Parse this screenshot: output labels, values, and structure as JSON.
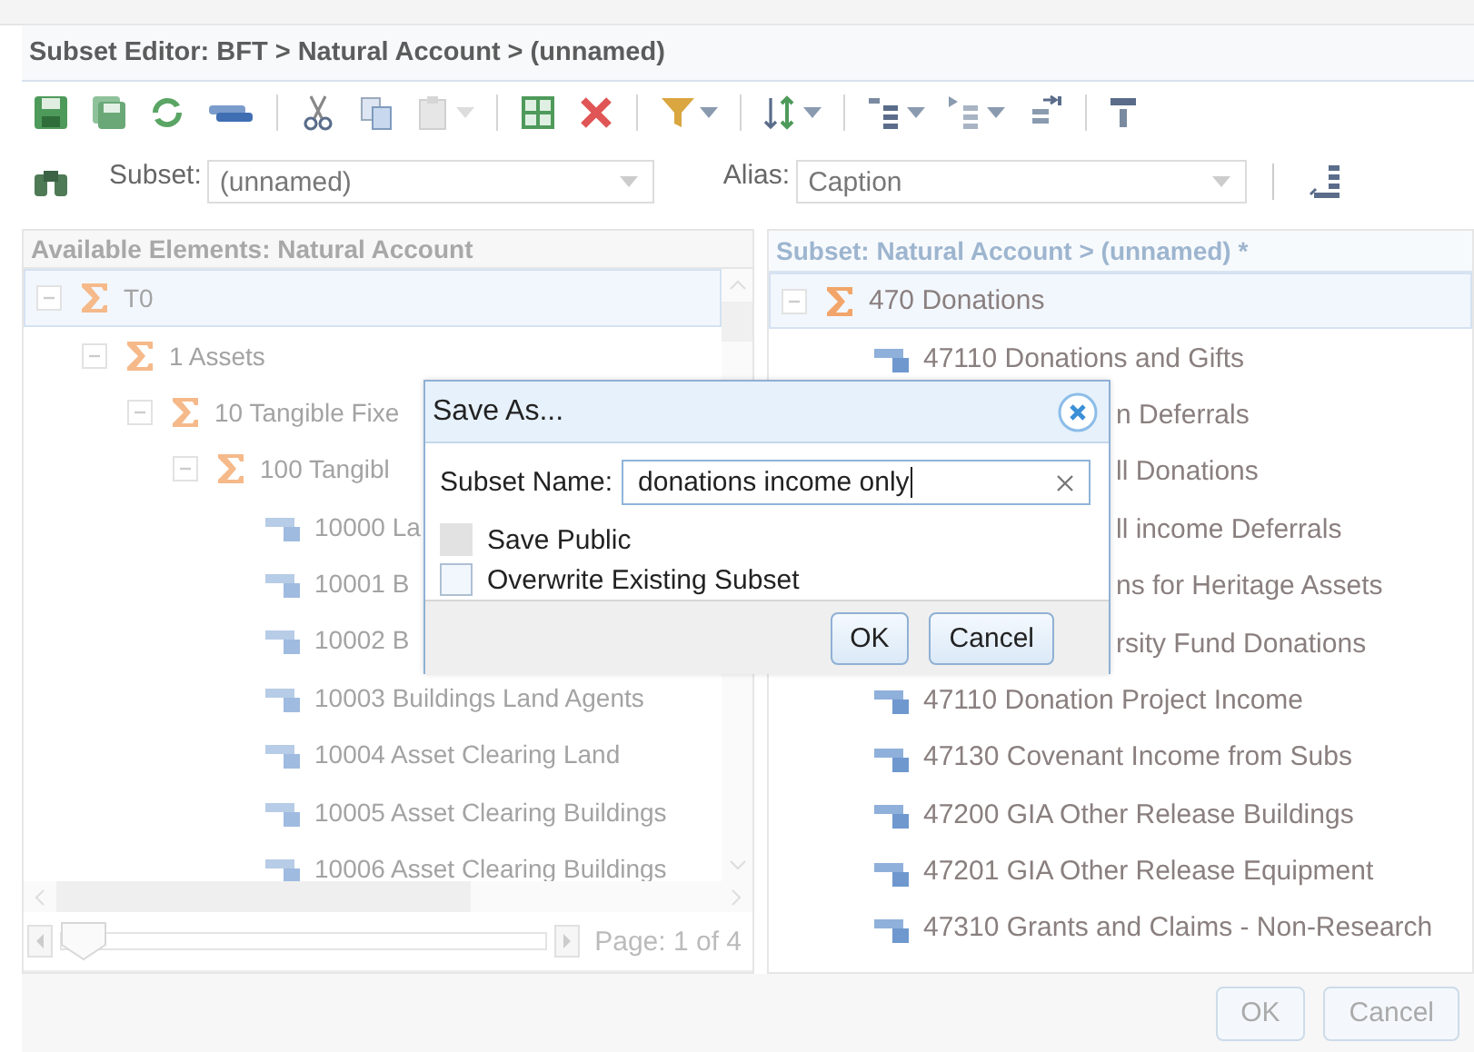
{
  "window": {
    "title": "Subset Editor: BFT > Natural Account > (unnamed)"
  },
  "subset_selector": {
    "label": "Subset:",
    "value": "(unnamed)"
  },
  "alias_selector": {
    "label": "Alias:",
    "value": "Caption"
  },
  "available_elements": {
    "title": "Available Elements: Natural Account",
    "tree": [
      {
        "label": "T0",
        "kind": "consolidated",
        "expanded": true,
        "selected": true,
        "children": [
          {
            "label": "1 Assets",
            "kind": "consolidated",
            "expanded": true,
            "selected": false,
            "children": [
              {
                "label": "10 Tangible Fixe",
                "kind": "consolidated",
                "expanded": true,
                "selected": false,
                "children": [
                  {
                    "label": "100 Tangibl",
                    "kind": "consolidated",
                    "expanded": true,
                    "selected": false,
                    "children": [
                      {
                        "label": "10000 La",
                        "kind": "leaf",
                        "selected": false
                      },
                      {
                        "label": "10001 B",
                        "kind": "leaf",
                        "selected": false
                      },
                      {
                        "label": "10002 B",
                        "kind": "leaf",
                        "selected": false
                      },
                      {
                        "label": "10003 Buildings Land Agents",
                        "kind": "leaf",
                        "selected": false
                      },
                      {
                        "label": "10004 Asset Clearing Land",
                        "kind": "leaf",
                        "selected": false
                      },
                      {
                        "label": "10005 Asset Clearing Buildings",
                        "kind": "leaf",
                        "selected": false
                      },
                      {
                        "label": "10006 Asset Clearing Buildings",
                        "kind": "leaf",
                        "selected": false
                      }
                    ]
                  }
                ]
              }
            ]
          }
        ]
      }
    ],
    "pager": {
      "level": 0,
      "text": "Page: 1 of 4"
    }
  },
  "subset": {
    "title": "Subset: Natural Account > (unnamed) *",
    "tree": [
      {
        "label": "470 Donations",
        "kind": "consolidated",
        "expanded": true,
        "selected": true,
        "children": [
          {
            "label": "47110 Donations and Gifts",
            "kind": "leaf",
            "selected": false
          },
          {
            "label": "n Deferrals",
            "kind": "covered",
            "selected": false
          },
          {
            "label": "ll Donations",
            "kind": "covered",
            "selected": false
          },
          {
            "label": "ll income Deferrals",
            "kind": "covered",
            "selected": false
          },
          {
            "label": "ns for Heritage Assets",
            "kind": "covered",
            "selected": false
          },
          {
            "label": "rsity Fund Donations",
            "kind": "covered",
            "selected": false
          },
          {
            "label": "47110 Donation Project Income",
            "kind": "leaf",
            "selected": false
          },
          {
            "label": "47130 Covenant Income from Subs",
            "kind": "leaf",
            "selected": false
          },
          {
            "label": "47200 GIA Other Release Buildings",
            "kind": "leaf",
            "selected": false
          },
          {
            "label": "47201 GIA Other Release Equipment",
            "kind": "leaf",
            "selected": false
          },
          {
            "label": "47310 Grants and Claims - Non-Research",
            "kind": "leaf",
            "selected": false
          }
        ]
      }
    ]
  },
  "dialog": {
    "title": "Save As...",
    "name_label": "Subset Name:",
    "name_value": "donations income only",
    "options": [
      {
        "label": "Save Public",
        "checked": false,
        "disabled": true
      },
      {
        "label": "Overwrite Existing Subset",
        "checked": false,
        "disabled": false
      }
    ],
    "buttons": [
      "OK",
      "Cancel"
    ]
  },
  "footer_buttons": [
    "OK",
    "Cancel"
  ]
}
